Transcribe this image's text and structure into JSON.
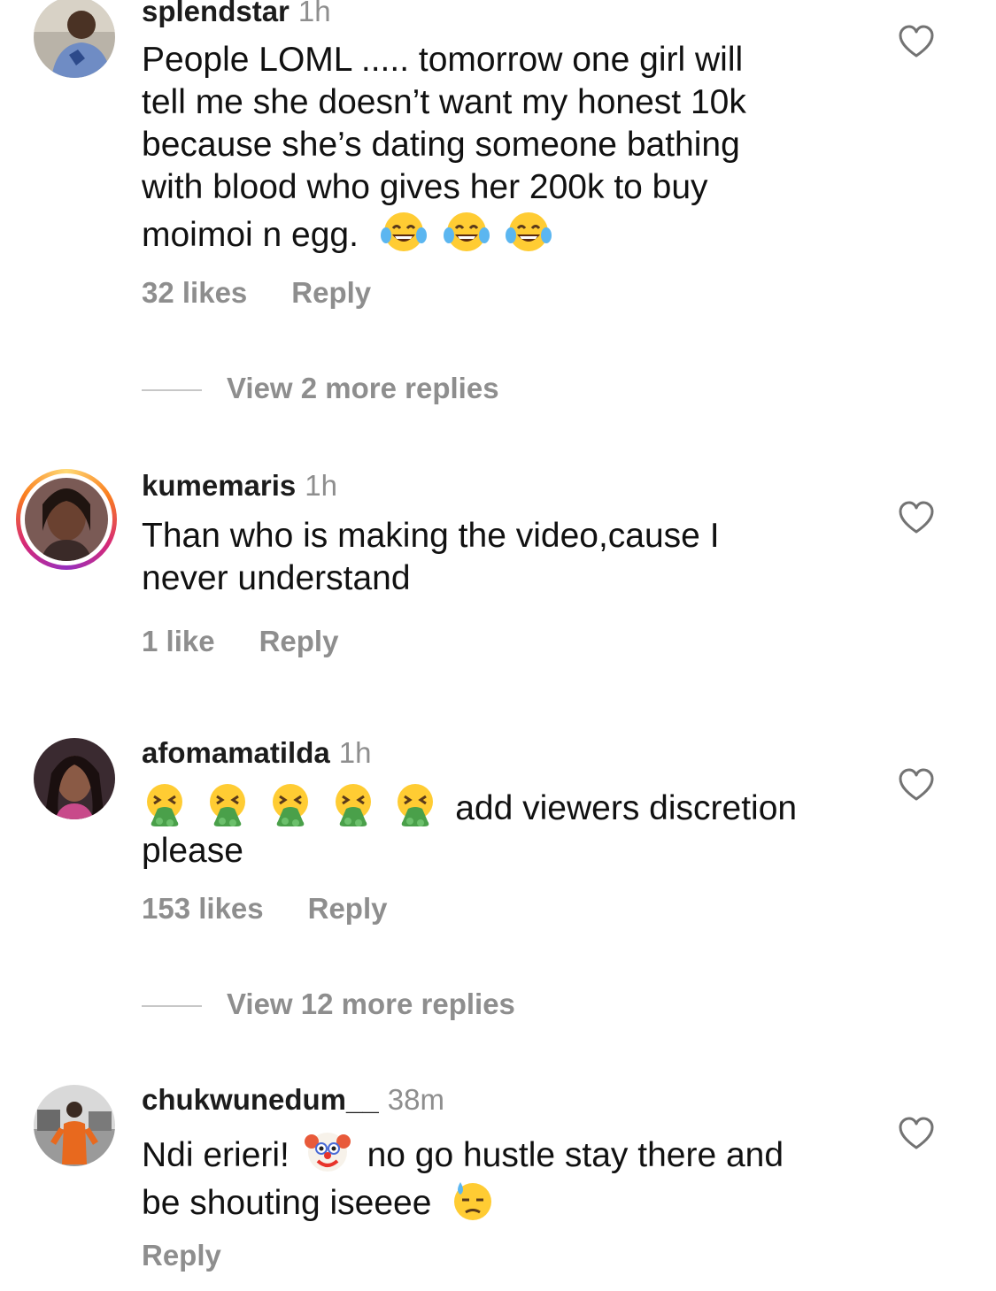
{
  "comments": [
    {
      "username": "splendstar",
      "time": "1h",
      "lines": [
        "People LOML ..... tomorrow one girl will",
        "tell me she doesn’t want my honest 10k",
        "because she’s dating someone bathing",
        "with blood who gives her 200k to buy",
        "moimoi n egg."
      ],
      "emojis_line5": [
        "tears-of-joy-emoji",
        "tears-of-joy-emoji",
        "tears-of-joy-emoji"
      ],
      "likes": "32 likes",
      "reply": "Reply",
      "more_replies": "View 2 more replies"
    },
    {
      "username": "kumemaris",
      "time": "1h",
      "lines": [
        "Than who is making the video,cause I",
        "never understand"
      ],
      "likes": "1 like",
      "reply": "Reply"
    },
    {
      "username": "afomamatilda",
      "time": "1h",
      "emojis": [
        "vomiting-face-emoji",
        "vomiting-face-emoji",
        "vomiting-face-emoji",
        "vomiting-face-emoji",
        "vomiting-face-emoji"
      ],
      "line1_text": "add viewers discretion",
      "line2_text": "please",
      "likes": "153 likes",
      "reply": "Reply",
      "more_replies": "View 12 more replies"
    },
    {
      "username": "chukwunedum__",
      "time": "38m",
      "line1_a": "Ndi erieri!",
      "line1_emoji": "clown-face-emoji",
      "line1_b": "no go hustle stay there and",
      "line2_text": "be shouting iseeee",
      "line2_emoji": "downcast-face-with-sweat-emoji",
      "reply": "Reply"
    }
  ],
  "icons": {
    "like": "heart-outline-icon"
  },
  "colors": {
    "secondary_text": "#8e8e8e",
    "primary_text": "#111111",
    "ring_start": "#feda75",
    "ring_end": "#962fbf"
  }
}
